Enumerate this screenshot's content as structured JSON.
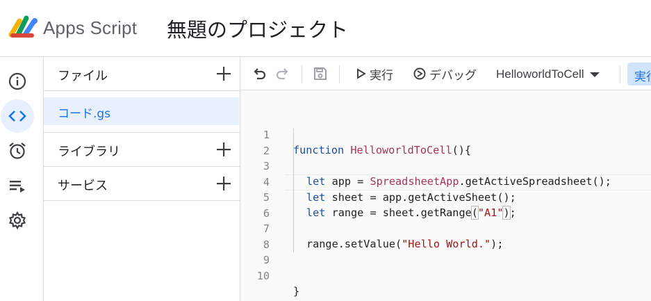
{
  "header": {
    "app_name": "Apps Script",
    "project_title": "無題のプロジェクト",
    "logo_icon": "apps-script-logo"
  },
  "rail": {
    "items": [
      {
        "icon": "info-icon",
        "label": "概要"
      },
      {
        "icon": "code-icon",
        "label": "エディタ",
        "active": true
      },
      {
        "icon": "alarm-clock-icon",
        "label": "トリガー"
      },
      {
        "icon": "executions-list-icon",
        "label": "実行数"
      },
      {
        "icon": "gear-icon",
        "label": "設定"
      }
    ]
  },
  "files_panel": {
    "files_label": "ファイル",
    "file_name": "コード.gs",
    "libraries_label": "ライブラリ",
    "services_label": "サービス"
  },
  "toolbar": {
    "run_label": "実行",
    "debug_label": "デバッグ",
    "function_name": "HelloworldToCell",
    "run_button_label": "実行"
  },
  "editor": {
    "line_numbers": [
      "1",
      "2",
      "3",
      "4",
      "5",
      "6",
      "7",
      "8",
      "9",
      "10"
    ],
    "current_line": 5
  },
  "colors": {
    "accent": "#1a73e8",
    "active_bg": "#e8f0fe",
    "keyword": "#1a4f9c",
    "function": "#a8325e",
    "string": "#a31515"
  }
}
